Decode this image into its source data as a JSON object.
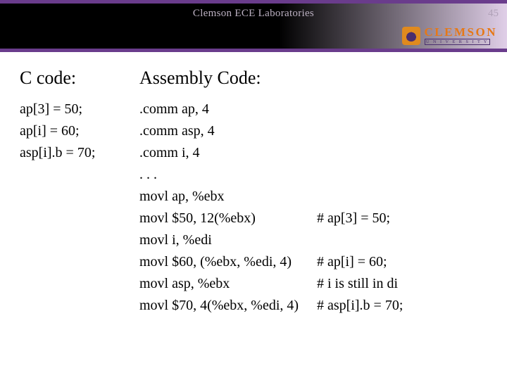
{
  "header": {
    "title": "Clemson ECE Laboratories",
    "page_number": "45",
    "logo_main": "CLEMSON",
    "logo_sub": "U N I V E R S I T Y"
  },
  "left": {
    "heading": "C code:",
    "lines": [
      "ap[3] = 50;",
      "ap[i] = 60;",
      "asp[i].b = 70;"
    ]
  },
  "right": {
    "heading": "Assembly Code:",
    "lines": [
      {
        "instr": ".comm ap, 4",
        "comment": ""
      },
      {
        "instr": ".comm asp, 4",
        "comment": ""
      },
      {
        "instr": ".comm i, 4",
        "comment": ""
      },
      {
        "instr": ". . .",
        "comment": ""
      },
      {
        "instr": "movl ap, %ebx",
        "comment": ""
      },
      {
        "instr": "movl $50, 12(%ebx)",
        "comment": "# ap[3] = 50;"
      },
      {
        "instr": "movl i, %edi",
        "comment": ""
      },
      {
        "instr": "movl $60, (%ebx, %edi, 4)",
        "comment": "# ap[i] = 60;"
      },
      {
        "instr": "movl asp, %ebx",
        "comment": "# i is still in di"
      },
      {
        "instr": "movl $70, 4(%ebx, %edi, 4)",
        "comment": "# asp[i].b = 70;"
      }
    ]
  }
}
